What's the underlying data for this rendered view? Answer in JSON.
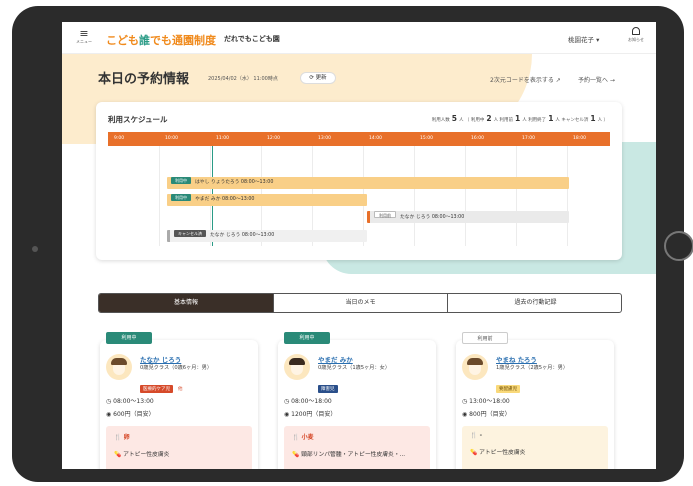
{
  "header": {
    "menu_label": "メニュー",
    "logo_part1": "こども",
    "logo_part2": "誰",
    "logo_part3": "でも通園制度",
    "facility": "だれでもこども園",
    "user": "桃園花子 ▾",
    "bell_label": "お知らせ"
  },
  "page": {
    "title": "本日の予約情報",
    "as_of": "2025/04/02（水） 11:00時点",
    "refresh_label": "⟳ 更新",
    "qr_link": "2次元コードを表示する ↗",
    "list_link": "予約一覧へ →"
  },
  "schedule": {
    "title": "利用スケジュール",
    "counts": [
      {
        "label": "利用人数",
        "value": "5",
        "unit": "人"
      },
      {
        "label": "利用中",
        "value": "2",
        "unit": "人"
      },
      {
        "label": "利用前",
        "value": "1",
        "unit": "人"
      },
      {
        "label": "利用終了",
        "value": "1",
        "unit": "人"
      },
      {
        "label": "キャンセル済",
        "value": "1",
        "unit": "人"
      }
    ],
    "hours": [
      "9:00",
      "10:00",
      "11:00",
      "12:00",
      "13:00",
      "14:00",
      "15:00",
      "16:00",
      "17:00",
      "18:00"
    ],
    "bars": [
      {
        "status": "利用中",
        "text": "はやし りょうたろう 08:00〜13:00"
      },
      {
        "status": "利用中",
        "text": "やまだ みか 08:00〜13:00"
      },
      {
        "status": "利用前",
        "text": "たなか じろう 08:00〜13:00"
      },
      {
        "status": "キャンセル済",
        "text": "たなか じろう 08:00〜13:00"
      }
    ]
  },
  "tabs": [
    "基本情報",
    "当日のメモ",
    "過去の行動記録"
  ],
  "cards": [
    {
      "status": "利用中",
      "name": "たなか じろう",
      "class": "0歳児クラス（0歳6ヶ月：男）",
      "tags": [
        "医療的ケア児",
        "他"
      ],
      "time": "◷ 08:00〜13:00",
      "fee": "◉ 600円（目安）",
      "allergy": "卵",
      "disease": "アトピー性皮膚炎"
    },
    {
      "status": "利用中",
      "name": "やまだ みか",
      "class": "0歳児クラス（1歳5ヶ月：女）",
      "tags": [
        "障害児"
      ],
      "time": "◷ 08:00〜18:00",
      "fee": "◉ 1200円（目安）",
      "allergy": "小麦",
      "disease": "頸部リンパ管腫・アトピー性皮膚炎・..."
    },
    {
      "status": "利用前",
      "name": "やまね たろう",
      "class": "1歳児クラス（2歳5ヶ月：男）",
      "tags": [
        "要配慮児"
      ],
      "time": "◷ 13:00〜18:00",
      "fee": "◉ 800円（目安）",
      "allergy": "-",
      "disease": "アトピー性皮膚炎"
    }
  ],
  "colors": {
    "orange": "#e8702a",
    "teal": "#2a8a78",
    "cream": "#fdeccd",
    "mint": "#c9e8e3"
  }
}
